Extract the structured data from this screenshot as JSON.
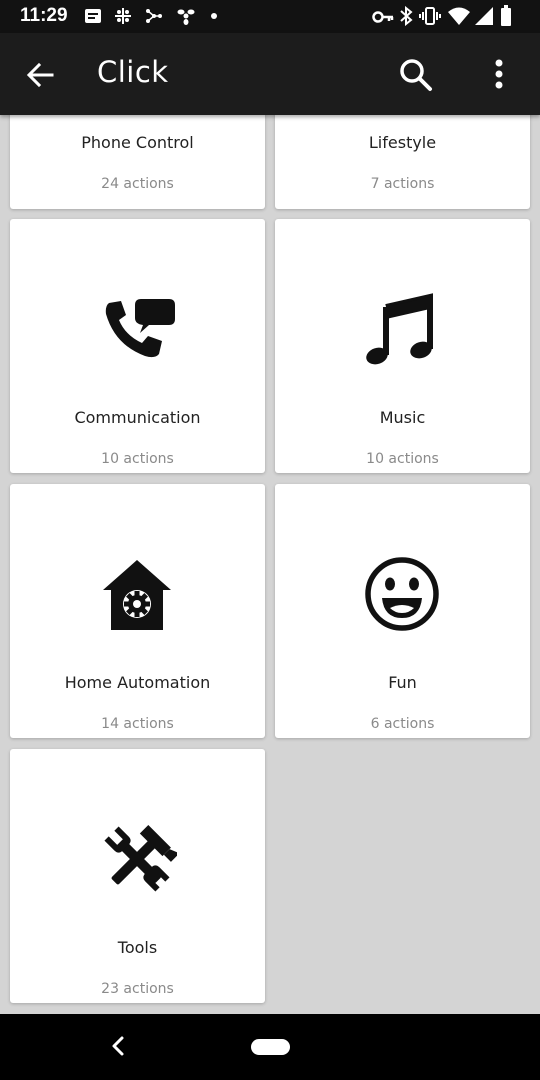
{
  "status_bar": {
    "time": "11:29",
    "icons_left": [
      "message-icon",
      "slack-icon",
      "network-icon",
      "fan-icon",
      "dot-icon"
    ],
    "icons_right": [
      "key-icon",
      "bluetooth-icon",
      "vibrate-icon",
      "wifi-icon",
      "signal-icon",
      "battery-icon"
    ]
  },
  "app_bar": {
    "title": "Click",
    "icons": [
      "back-arrow-icon",
      "search-icon",
      "more-vert-icon"
    ]
  },
  "categories": [
    {
      "name": "Phone Control",
      "count": "24 actions"
    },
    {
      "name": "Lifestyle",
      "count": "7 actions"
    },
    {
      "name": "Communication",
      "count": "10 actions",
      "icon": "phone-chat-icon"
    },
    {
      "name": "Music",
      "count": "10 actions",
      "icon": "music-note-icon"
    },
    {
      "name": "Home Automation",
      "count": "14 actions",
      "icon": "home-gear-icon"
    },
    {
      "name": "Fun",
      "count": "6 actions",
      "icon": "smiley-icon"
    },
    {
      "name": "Tools",
      "count": "23 actions",
      "icon": "tools-icon"
    }
  ],
  "colors": {
    "background": "#d4d4d4",
    "app_bar": "#1c1c1c",
    "status_bar": "#121212",
    "card": "#ffffff",
    "count_text": "#8a8a8a"
  }
}
